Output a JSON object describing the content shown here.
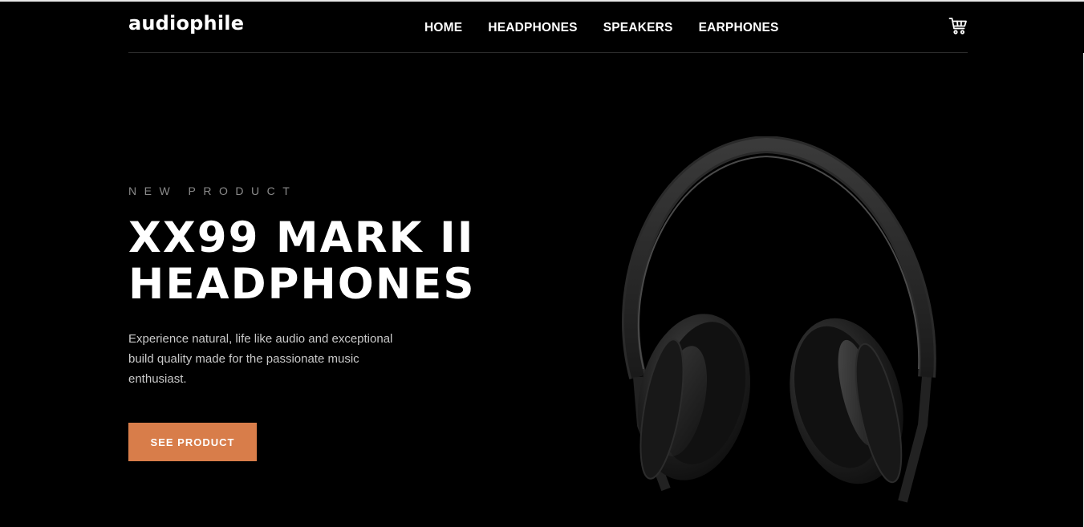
{
  "brand": {
    "logo_text": "audiophile"
  },
  "nav": {
    "items": [
      {
        "label": "HOME"
      },
      {
        "label": "HEADPHONES"
      },
      {
        "label": "SPEAKERS"
      },
      {
        "label": "EARPHONES"
      }
    ]
  },
  "hero": {
    "overline": "NEW PRODUCT",
    "title_line1": "XX99 MARK II",
    "title_line2": "HEADPHONES",
    "description": "Experience natural, life like audio and exceptional build quality made for the passionate music enthusiast.",
    "cta_label": "SEE PRODUCT"
  },
  "icons": {
    "cart": "cart-icon",
    "product": "headphones-image"
  },
  "colors": {
    "background": "#000000",
    "accent": "#d87d4a",
    "text": "#ffffff",
    "muted": "#8a8a8a"
  }
}
